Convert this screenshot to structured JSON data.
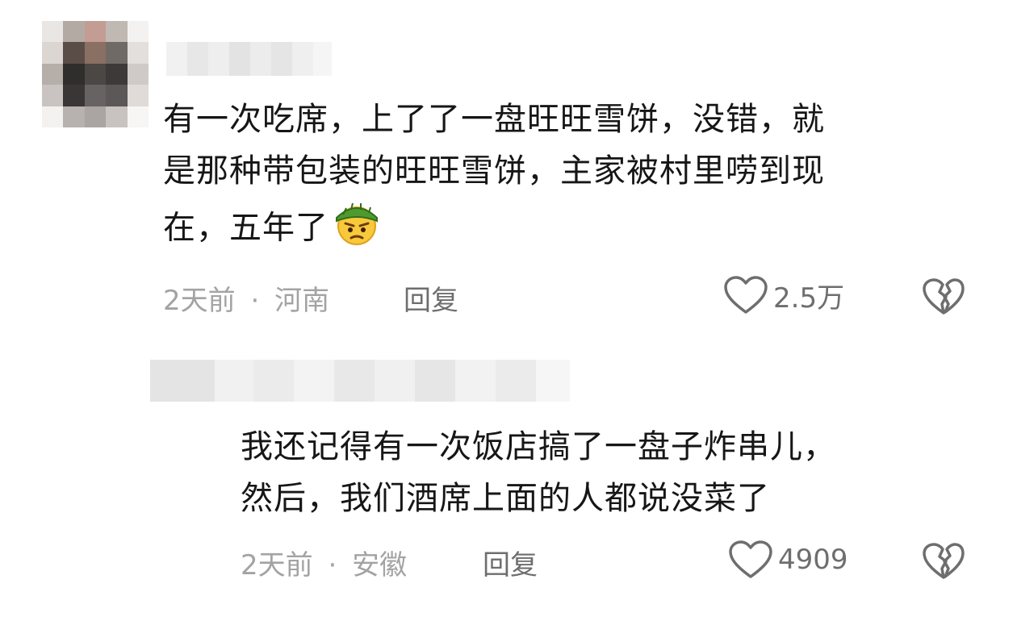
{
  "comments": [
    {
      "text_lines": [
        "有一次吃席，上了了一盘旺旺雪饼，没错，就",
        "是那种带包装的旺旺雪饼，主家被村里唠到现",
        "在，五年了"
      ],
      "emoji_icon": "suspicious-face-green-hat-emoji",
      "time": "2天前",
      "separator": "·",
      "location": "河南",
      "reply_label": "回复",
      "likes": "2.5万"
    },
    {
      "text_lines": [
        "我还记得有一次饭店搞了一盘子炸串儿，",
        "然后，我们酒席上面的人都说没菜了"
      ],
      "time": "2天前",
      "separator": "·",
      "location": "安徽",
      "reply_label": "回复",
      "likes": "4909"
    }
  ],
  "icons": {
    "like": "heart-outline-icon",
    "dislike": "broken-heart-outline-icon"
  },
  "colors": {
    "text": "#161616",
    "meta": "#a3a3a3",
    "reply": "#6e6e6e",
    "icon_stroke": "#6e6e6e"
  }
}
